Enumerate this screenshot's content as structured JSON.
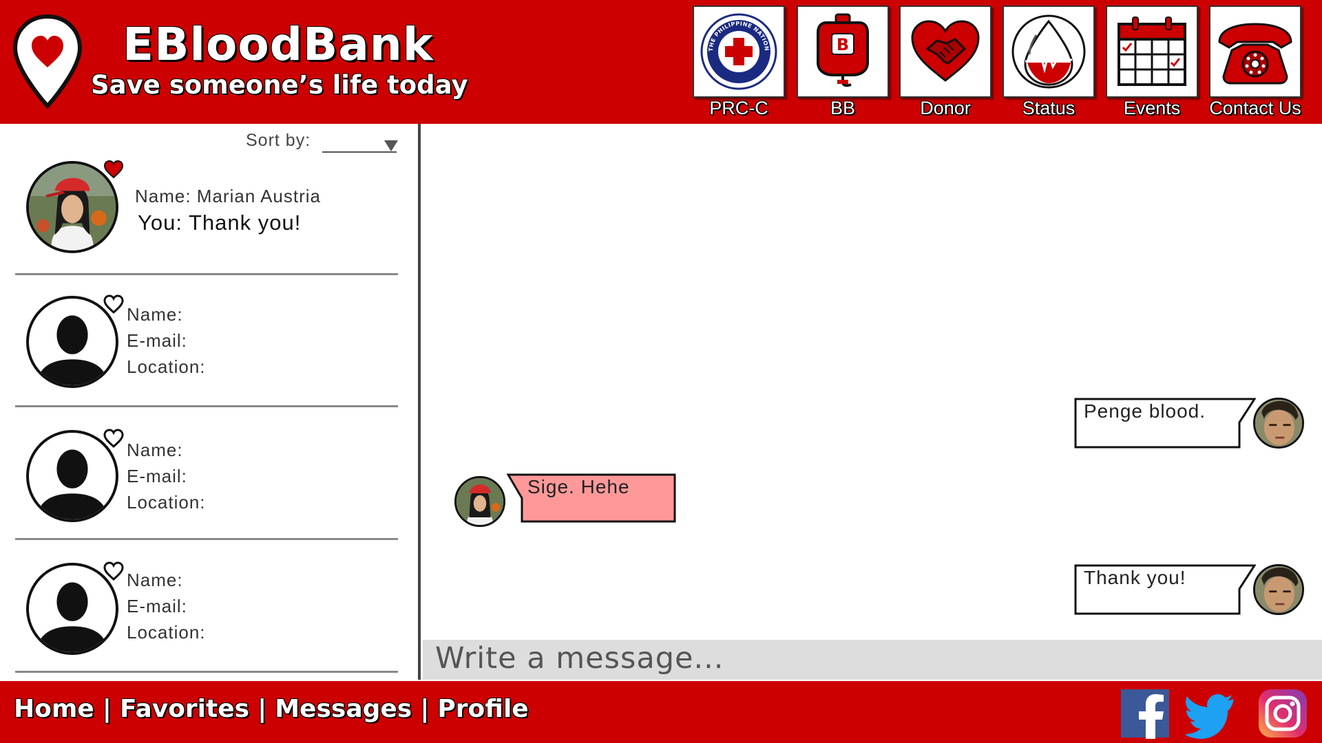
{
  "brand": {
    "title": "EBloodBank",
    "subtitle": "Save someone’s life today"
  },
  "colors": {
    "brand_red": "#cc0000",
    "bubble_incoming": "#ff9999",
    "bubble_outgoing": "#ffffff",
    "composer_bg": "#dddddd"
  },
  "nav": [
    {
      "label": "PRC-C",
      "icon": "red-cross-seal-icon",
      "seal_text": "THE PHILIPPINE NATIONAL RED CROSS"
    },
    {
      "label": "BB",
      "icon": "blood-bag-icon",
      "badge": "B"
    },
    {
      "label": "Donor",
      "icon": "heart-handshake-icon"
    },
    {
      "label": "Status",
      "icon": "blood-drop-heartbeat-icon"
    },
    {
      "label": "Events",
      "icon": "calendar-icon"
    },
    {
      "label": "Contact Us",
      "icon": "telephone-icon"
    }
  ],
  "sidebar": {
    "sort_label": "Sort by:",
    "sort_value": "",
    "contacts": [
      {
        "name_line": "Name: Marian Austria",
        "preview": "You: Thank you!",
        "favorite": true,
        "avatar": "profile-photo"
      },
      {
        "name_line": "Name:",
        "email_line": "E-mail:",
        "location_line": "Location:",
        "favorite": false,
        "avatar": "placeholder-silhouette"
      },
      {
        "name_line": "Name:",
        "email_line": "E-mail:",
        "location_line": "Location:",
        "favorite": false,
        "avatar": "placeholder-silhouette"
      },
      {
        "name_line": "Name:",
        "email_line": "E-mail:",
        "location_line": "Location:",
        "favorite": false,
        "avatar": "placeholder-silhouette"
      }
    ]
  },
  "chat": {
    "messages": [
      {
        "from": "me",
        "text": "Penge blood."
      },
      {
        "from": "them",
        "text": "Sige. Hehe"
      },
      {
        "from": "me",
        "text": "Thank you!"
      }
    ],
    "composer_placeholder": "Write a message..."
  },
  "footer": {
    "links": [
      "Home",
      "Favorites",
      "Messages",
      "Profile"
    ],
    "separator": "|",
    "social": [
      "facebook-icon",
      "twitter-icon",
      "instagram-icon"
    ]
  }
}
